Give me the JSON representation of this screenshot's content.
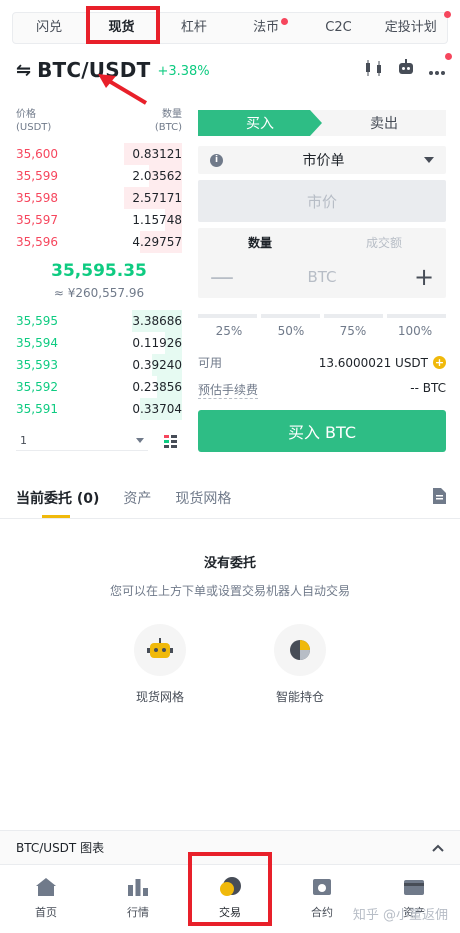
{
  "top_tabs": [
    "闪兑",
    "现货",
    "杠杆",
    "法币",
    "C2C",
    "定投计划"
  ],
  "pair": {
    "swap_icon": "⇋",
    "name": "BTC/USDT",
    "change": "+3.38%"
  },
  "order_book": {
    "price_header": [
      "价格",
      "(USDT)"
    ],
    "qty_header": [
      "数量",
      "(BTC)"
    ],
    "asks": [
      {
        "price": "35,600",
        "qty": "0.83121",
        "depth": 0.35
      },
      {
        "price": "35,599",
        "qty": "2.03562",
        "depth": 0.2
      },
      {
        "price": "35,598",
        "qty": "2.57171",
        "depth": 0.35
      },
      {
        "price": "35,597",
        "qty": "1.15748",
        "depth": 0.1
      },
      {
        "price": "35,596",
        "qty": "4.29757",
        "depth": 0.25
      }
    ],
    "mid_price": "35,595.35",
    "mid_cny": "≈ ¥260,557.96",
    "bids": [
      {
        "price": "35,595",
        "qty": "3.38686",
        "depth": 0.3
      },
      {
        "price": "35,594",
        "qty": "0.11926",
        "depth": 0.1
      },
      {
        "price": "35,593",
        "qty": "0.39240",
        "depth": 0.18
      },
      {
        "price": "35,592",
        "qty": "0.23856",
        "depth": 0.15
      },
      {
        "price": "35,591",
        "qty": "0.33704",
        "depth": 0.25
      }
    ],
    "depth_select": "1"
  },
  "trade": {
    "buy_tab": "买入",
    "sell_tab": "卖出",
    "order_type": "市价单",
    "price_placeholder": "市价",
    "amount_tab": "数量",
    "turnover_tab": "成交额",
    "unit": "BTC",
    "minus": "—",
    "plus": "+",
    "percents": [
      "25%",
      "50%",
      "75%",
      "100%"
    ],
    "available_label": "可用",
    "available_value": "13.6000021 USDT",
    "fee_label": "预估手续费",
    "fee_value": "-- BTC",
    "buy_button": "买入 BTC"
  },
  "orders": {
    "tabs": [
      "当前委托 (0)",
      "资产",
      "现货网格"
    ],
    "empty_title": "没有委托",
    "empty_desc": "您可以在上方下单或设置交易机器人自动交易",
    "features": [
      "现货网格",
      "智能持仓"
    ]
  },
  "chart_bar": {
    "label": "BTC/USDT 图表"
  },
  "bottom_nav": [
    "首页",
    "行情",
    "交易",
    "合约",
    "资产"
  ],
  "watermark": "知乎 @小董返佣",
  "colors": {
    "green": "#0ecb81",
    "red": "#f6465d",
    "yellow": "#f0b90b",
    "highlight": "#e8202a"
  }
}
